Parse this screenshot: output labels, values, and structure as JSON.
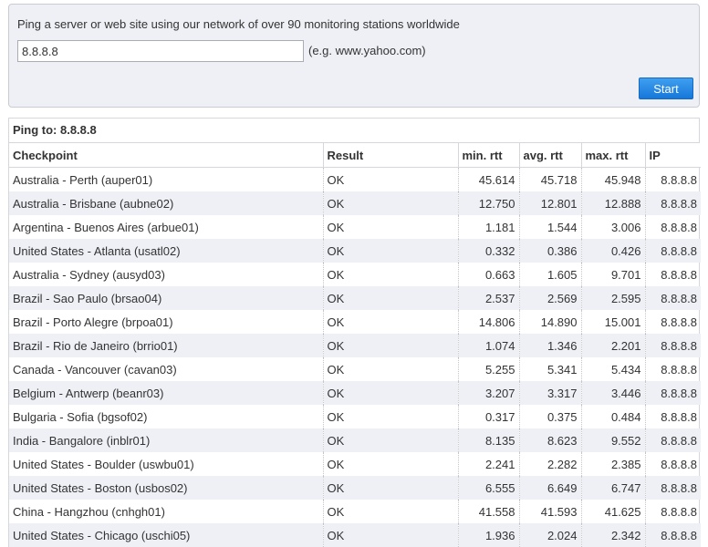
{
  "form": {
    "intro": "Ping a server or web site using our network of over 90 monitoring stations worldwide",
    "host_value": "8.8.8.8",
    "hint": "(e.g. www.yahoo.com)",
    "start_label": "Start"
  },
  "results": {
    "heading": "Ping to: 8.8.8.8",
    "columns": [
      "Checkpoint",
      "Result",
      "min. rtt",
      "avg. rtt",
      "max. rtt",
      "IP"
    ],
    "rows": [
      {
        "checkpoint": "Australia - Perth (auper01)",
        "result": "OK",
        "min": "45.614",
        "avg": "45.718",
        "max": "45.948",
        "ip": "8.8.8.8"
      },
      {
        "checkpoint": "Australia - Brisbane (aubne02)",
        "result": "OK",
        "min": "12.750",
        "avg": "12.801",
        "max": "12.888",
        "ip": "8.8.8.8"
      },
      {
        "checkpoint": "Argentina - Buenos Aires (arbue01)",
        "result": "OK",
        "min": "1.181",
        "avg": "1.544",
        "max": "3.006",
        "ip": "8.8.8.8"
      },
      {
        "checkpoint": "United States - Atlanta (usatl02)",
        "result": "OK",
        "min": "0.332",
        "avg": "0.386",
        "max": "0.426",
        "ip": "8.8.8.8"
      },
      {
        "checkpoint": "Australia - Sydney (ausyd03)",
        "result": "OK",
        "min": "0.663",
        "avg": "1.605",
        "max": "9.701",
        "ip": "8.8.8.8"
      },
      {
        "checkpoint": "Brazil - Sao Paulo (brsao04)",
        "result": "OK",
        "min": "2.537",
        "avg": "2.569",
        "max": "2.595",
        "ip": "8.8.8.8"
      },
      {
        "checkpoint": "Brazil - Porto Alegre (brpoa01)",
        "result": "OK",
        "min": "14.806",
        "avg": "14.890",
        "max": "15.001",
        "ip": "8.8.8.8"
      },
      {
        "checkpoint": "Brazil - Rio de Janeiro (brrio01)",
        "result": "OK",
        "min": "1.074",
        "avg": "1.346",
        "max": "2.201",
        "ip": "8.8.8.8"
      },
      {
        "checkpoint": "Canada - Vancouver (cavan03)",
        "result": "OK",
        "min": "5.255",
        "avg": "5.341",
        "max": "5.434",
        "ip": "8.8.8.8"
      },
      {
        "checkpoint": "Belgium - Antwerp (beanr03)",
        "result": "OK",
        "min": "3.207",
        "avg": "3.317",
        "max": "3.446",
        "ip": "8.8.8.8"
      },
      {
        "checkpoint": "Bulgaria - Sofia (bgsof02)",
        "result": "OK",
        "min": "0.317",
        "avg": "0.375",
        "max": "0.484",
        "ip": "8.8.8.8"
      },
      {
        "checkpoint": "India - Bangalore (inblr01)",
        "result": "OK",
        "min": "8.135",
        "avg": "8.623",
        "max": "9.552",
        "ip": "8.8.8.8"
      },
      {
        "checkpoint": "United States - Boulder (uswbu01)",
        "result": "OK",
        "min": "2.241",
        "avg": "2.282",
        "max": "2.385",
        "ip": "8.8.8.8"
      },
      {
        "checkpoint": "United States - Boston (usbos02)",
        "result": "OK",
        "min": "6.555",
        "avg": "6.649",
        "max": "6.747",
        "ip": "8.8.8.8"
      },
      {
        "checkpoint": "China - Hangzhou (cnhgh01)",
        "result": "OK",
        "min": "41.558",
        "avg": "41.593",
        "max": "41.625",
        "ip": "8.8.8.8"
      },
      {
        "checkpoint": "United States - Chicago (uschi05)",
        "result": "OK",
        "min": "1.936",
        "avg": "2.024",
        "max": "2.342",
        "ip": "8.8.8.8"
      }
    ]
  }
}
